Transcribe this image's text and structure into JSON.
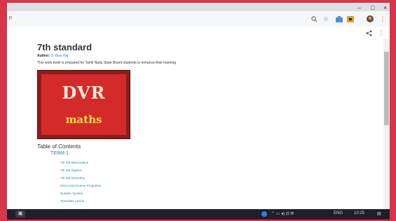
{
  "window": {
    "minimize_label": "–",
    "maximize_label": "□",
    "close_label": "×"
  },
  "addressbar": {
    "url_fragment": "p"
  },
  "icons": {
    "search": "search-icon",
    "star": "star-icon",
    "extension": "extension-icon",
    "profile": "profile-icon",
    "menu": "menu-icon",
    "share": "share-icon",
    "more": "more-icon"
  },
  "document": {
    "title": "7th standard",
    "author_label": "Author:",
    "author_name": "D.Vasu Raj",
    "description": "This work book is prepared for Tamil Nadu State Board students to enhance their learning",
    "cover": {
      "line1": "DVR",
      "line2": "maths"
    },
    "toc_title": "Table of Contents",
    "term": "TERM-1",
    "toc_items": [
      "7th Std Mensuration",
      "7th Std Algebra",
      "7th Std Geometry",
      "Direct and Inverse Proportion",
      "Number System",
      "Tessellate puzzle"
    ]
  },
  "taskbar": {
    "lang": "ENG",
    "time": "10:25"
  },
  "colors": {
    "frame_border": "#d8344a",
    "cover_red": "#d42a2a",
    "maths_yellow": "#f4e23a",
    "link_teal": "#2f8a8e",
    "taskbar": "#1f1f2a"
  }
}
